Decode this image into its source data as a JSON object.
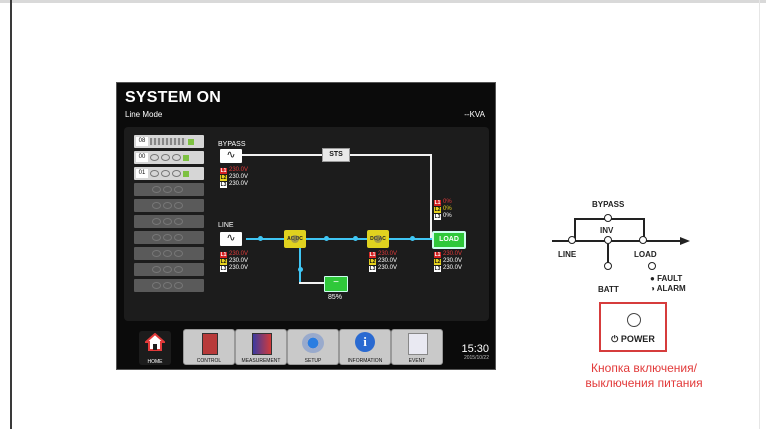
{
  "screen": {
    "title": "SYSTEM ON",
    "mode": "Line Mode",
    "kva": "--KVA",
    "modules": [
      "08",
      "00",
      "01",
      "",
      "",
      "",
      "",
      "",
      "",
      ""
    ],
    "bypass_label": "BYPASS",
    "line_label": "LINE",
    "sts_label": "STS",
    "load_label": "LOAD",
    "rectifier_label": "AC|DC",
    "inverter_label": "DC|AC",
    "wave_symbol": "∿",
    "battery_percent": "85%",
    "phase_tags": [
      "L1",
      "L2",
      "L3"
    ],
    "bypass_voltages": [
      "230.0V",
      "230.0V",
      "230.0V"
    ],
    "line_voltages": [
      "230.0V",
      "230.0V",
      "230.0V"
    ],
    "inverter_voltages": [
      "230.0V",
      "230.0V",
      "230.0V"
    ],
    "load_percents": [
      "0%",
      "0%",
      "0%"
    ],
    "load_voltages": [
      "230.0V",
      "230.0V",
      "230.0V"
    ],
    "nav": {
      "home": "HOME",
      "control": "CONTROL",
      "measurement": "MEASUREMENT",
      "setup": "SETUP",
      "information": "INFORMATION",
      "event": "EVENT"
    },
    "time": "15:30",
    "date": "2015/10/22"
  },
  "panel": {
    "bypass": "BYPASS",
    "inv": "INV",
    "line": "LINE",
    "load": "LOAD",
    "batt": "BATT",
    "fault": "FAULT",
    "alarm": "ALARM",
    "power": "POWER",
    "power_symbol": "⏻"
  },
  "caption": "Кнопка включения/выключения питания",
  "colors": {
    "accent": "#e23a3a",
    "green": "#2fc83a",
    "yellow": "#e0d21f",
    "cyan": "#40c6f4"
  }
}
